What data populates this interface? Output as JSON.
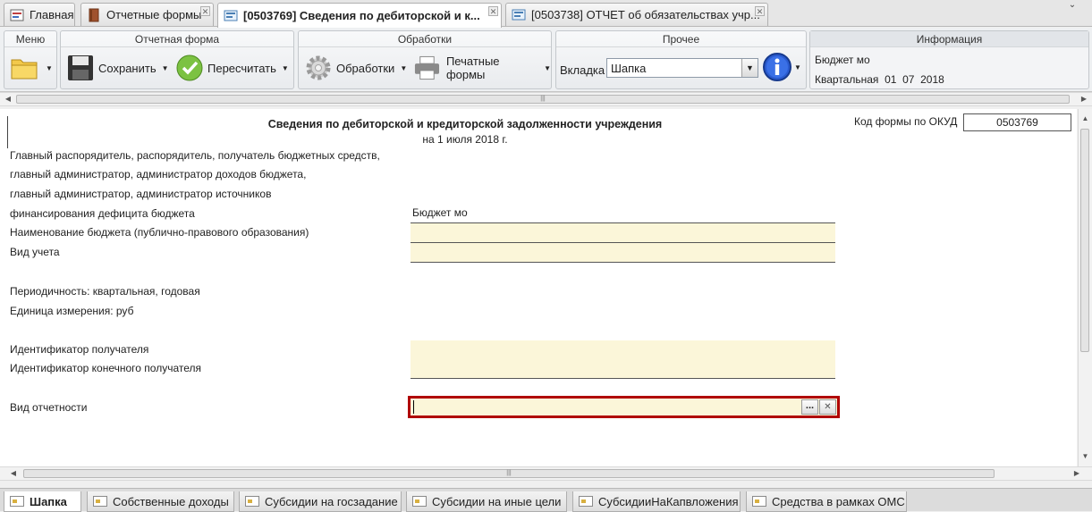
{
  "tabs": [
    {
      "label": "Главная"
    },
    {
      "label": "Отчетные формы"
    },
    {
      "label": "[0503769] Сведения по дебиторской и к..."
    },
    {
      "label": "[0503738] ОТЧЕТ об обязательствах учр..."
    }
  ],
  "ribbon": {
    "menu_title": "Меню",
    "form_title": "Отчетная форма",
    "save_label": "Сохранить",
    "recalc_label": "Пересчитать",
    "processing_title": "Обработки",
    "processing_label": "Обработки",
    "print_label": "Печатные формы",
    "other_title": "Прочее",
    "tab_select_label": "Вкладка",
    "tab_select_value": "Шапка",
    "info_title": "Информация",
    "info_budget": "Бюджет мо",
    "info_period": "Квартальная  01  07  2018"
  },
  "document": {
    "title": "Сведения по дебиторской и кредиторской задолженности учреждения",
    "date_line": "на 1 июля 2018 г.",
    "okud_label": "Код формы по ОКУД",
    "okud_value": "0503769",
    "label_line1": "Главный распорядитель, распорядитель, получатель бюджетных средств,",
    "label_line2": "главный администратор, администратор доходов бюджета,",
    "label_line3": "главный администратор, администратор источников",
    "label_line4": "финансирования дефицита бюджета",
    "budget_value": "Бюджет мо",
    "budget_name_label": "Наименование бюджета (публично-правового образования)",
    "accounting_label": "Вид учета",
    "periodicity": "Периодичность: квартальная, годовая",
    "unit": "Единица измерения: руб",
    "recipient_id_label": "Идентификатор получателя",
    "final_recipient_id_label": "Идентификатор конечного получателя",
    "report_type_label": "Вид отчетности",
    "report_type_value": "",
    "ellipsis_label": "...",
    "clear_label": "✕"
  },
  "sheet_tabs": [
    {
      "label": "Шапка"
    },
    {
      "label": "Собственные доходы"
    },
    {
      "label": "Субсидии на госзадание"
    },
    {
      "label": "Субсидии на иные цели"
    },
    {
      "label": "СубсидииНаКапвложения"
    },
    {
      "label": "Средства в рамках ОМС"
    }
  ],
  "colors": {
    "field_fill": "#fbf6d9",
    "focus_border": "#b00000"
  }
}
